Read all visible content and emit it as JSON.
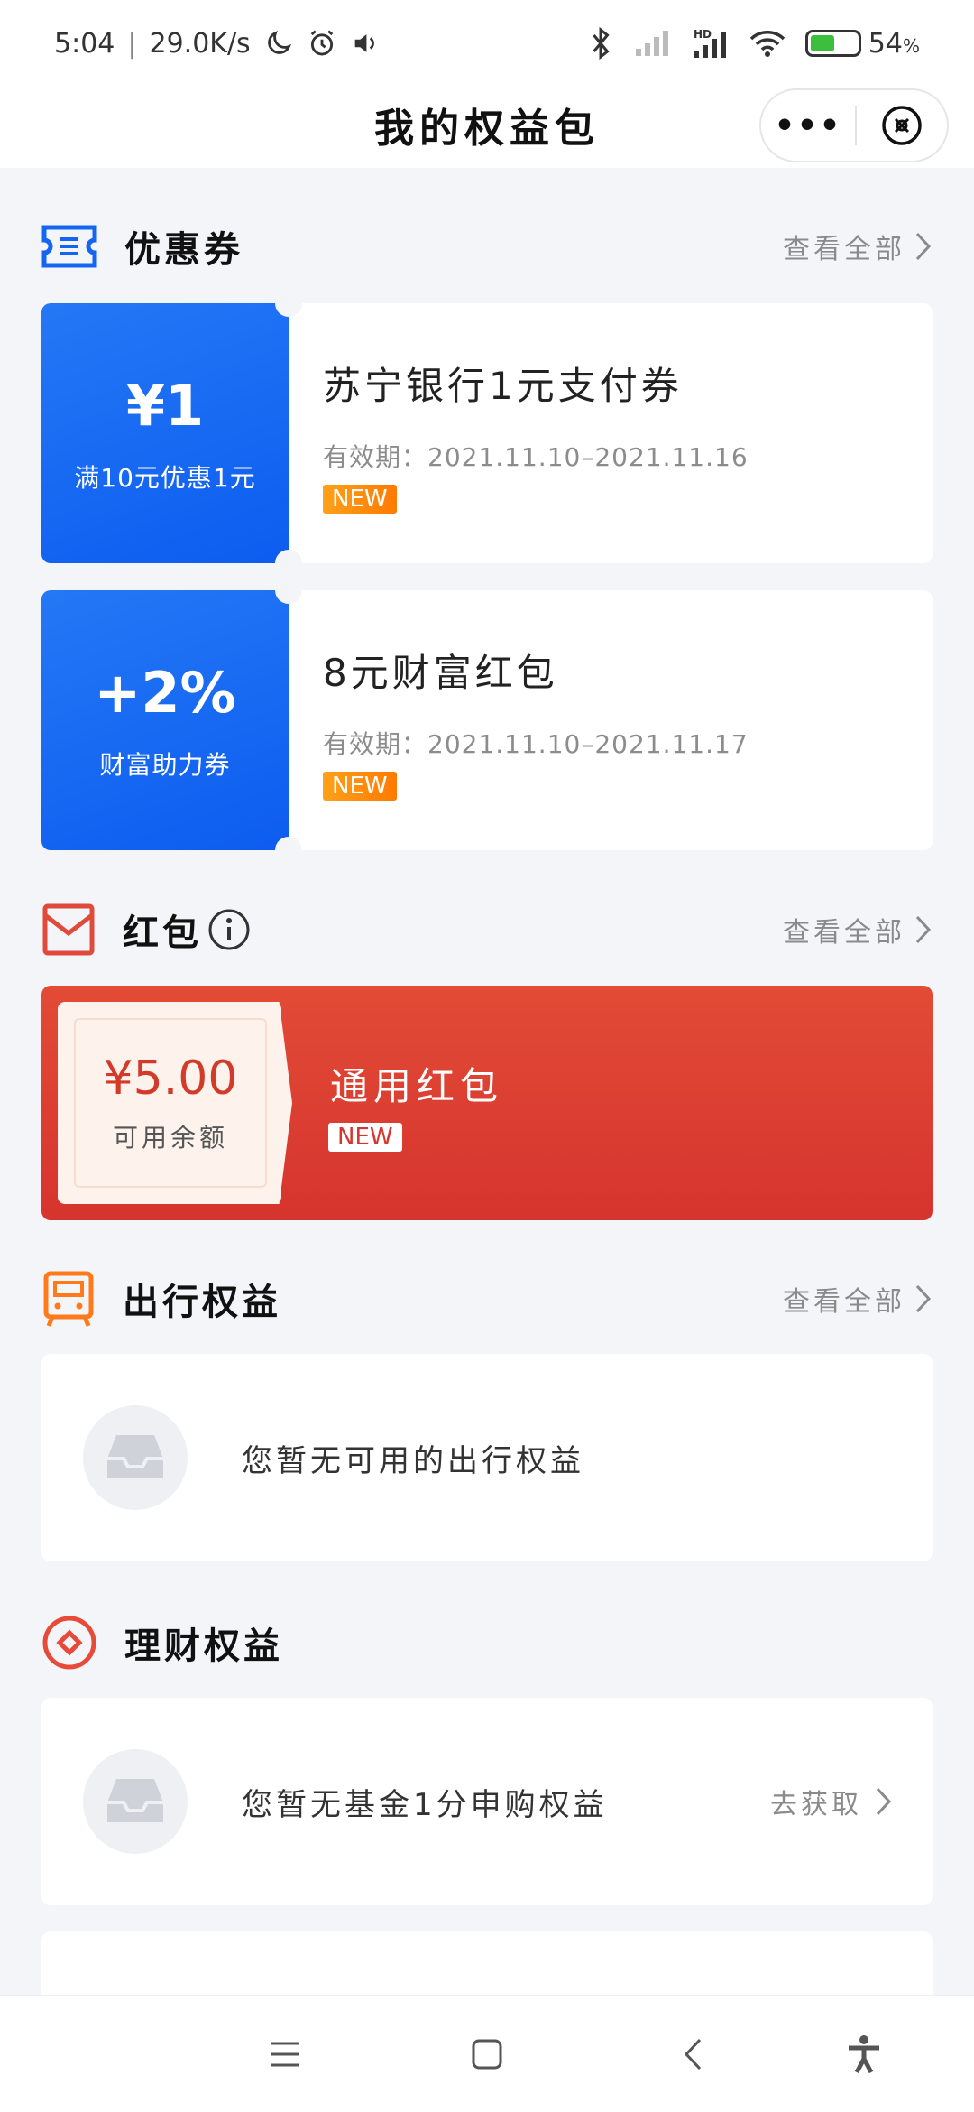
{
  "status_bar": {
    "time": "5:04",
    "speed": "29.0K/s",
    "battery_pct": "54",
    "battery_unit": "%"
  },
  "nav": {
    "title": "我的权益包",
    "more_label": "•••"
  },
  "coupon_section": {
    "title": "优惠券",
    "see_all": "查看全部",
    "coupons": [
      {
        "value": "¥1",
        "desc": "满10元优惠1元",
        "name": "苏宁银行1元支付券",
        "validity": "有效期：2021.11.10–2021.11.16",
        "badge": "NEW"
      },
      {
        "value": "+2%",
        "desc": "财富助力券",
        "name": "8元财富红包",
        "validity": "有效期：2021.11.10–2021.11.17",
        "badge": "NEW"
      }
    ]
  },
  "red_packet_section": {
    "title": "红包",
    "see_all": "查看全部",
    "amount": "¥5.00",
    "amount_label": "可用余额",
    "name": "通用红包",
    "badge": "NEW"
  },
  "travel_section": {
    "title": "出行权益",
    "see_all": "查看全部",
    "empty_text": "您暂无可用的出行权益"
  },
  "finance_section": {
    "title": "理财权益",
    "empty_text": "您暂无基金1分申购权益",
    "action": "去获取"
  },
  "colors": {
    "coupon_blue": "#1466f2",
    "red_packet": "#d6342e",
    "new_badge": "#ff8a00"
  }
}
